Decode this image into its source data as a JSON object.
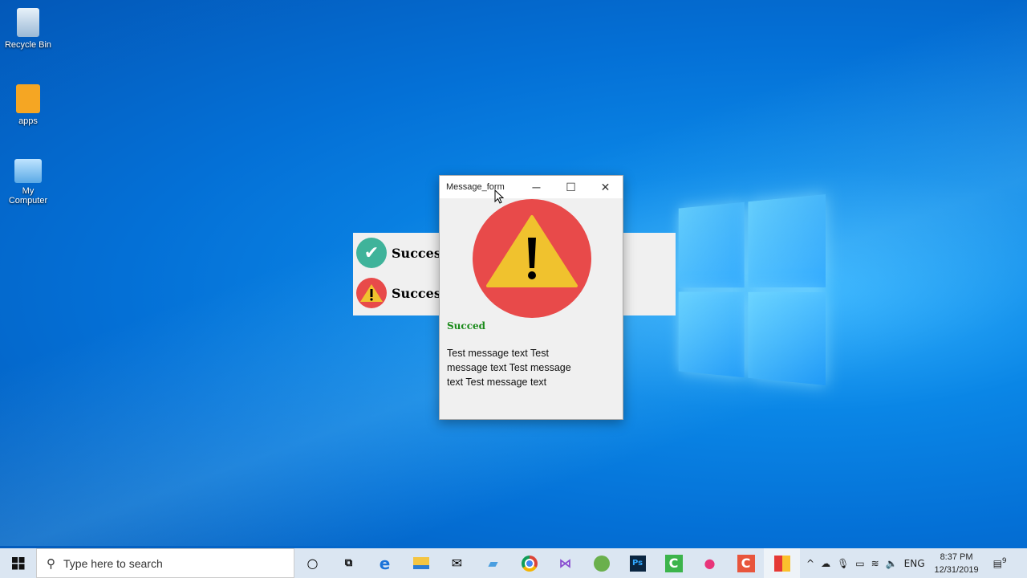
{
  "desktop": {
    "icons": [
      {
        "label": "Recycle Bin",
        "icon": "recycle-bin-icon"
      },
      {
        "label": "apps",
        "icon": "folder-icon"
      },
      {
        "label": "My Computer",
        "icon": "computer-icon"
      }
    ]
  },
  "background_panel": {
    "rows": [
      {
        "label": "Succes",
        "icon": "check-circle-icon",
        "color": "#3fb39a"
      },
      {
        "label": "Succes",
        "icon": "warning-circle-icon",
        "color": "#e84a4a"
      }
    ]
  },
  "window": {
    "title": "Message_form",
    "minimize": "─",
    "maximize": "☐",
    "close": "✕",
    "status_title": "Succed",
    "status_color": "#1a8a1a",
    "message": "Test message text Test message text Test message text Test message text",
    "icon": "warning-icon"
  },
  "taskbar": {
    "search_placeholder": "Type here to search",
    "apps": [
      "cortana",
      "task-view",
      "edge",
      "file-explorer",
      "mail",
      "app",
      "chrome",
      "visual-studio",
      "android-studio",
      "photoshop",
      "camtasia",
      "robot-app",
      "camtasia-recorder",
      "active-app"
    ],
    "language": "ENG",
    "time": "8:37 PM",
    "date": "12/31/2019",
    "notifications": "9"
  }
}
